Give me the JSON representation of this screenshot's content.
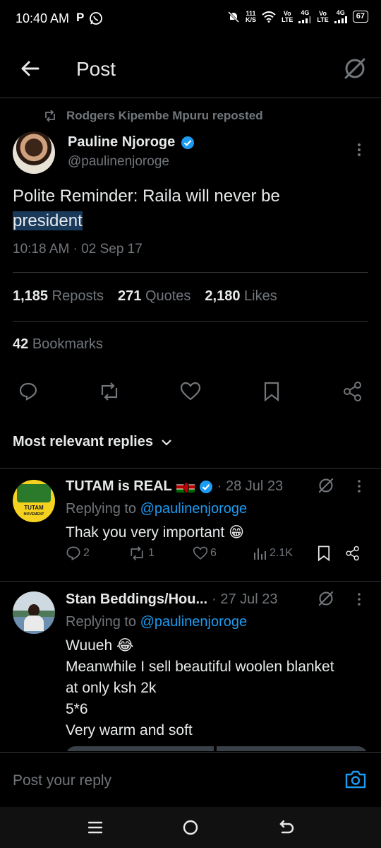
{
  "status_bar": {
    "time": "10:40 AM",
    "app_letter": "P",
    "net_speed_value": "111",
    "net_speed_unit": "K/S",
    "sim1_label_top": "Vo",
    "sim1_label_bottom": "LTE",
    "sim1_network": "4G",
    "sim2_label_top": "Vo",
    "sim2_label_bottom": "LTE",
    "sim2_network": "4G",
    "battery": "67"
  },
  "header": {
    "title": "Post"
  },
  "post": {
    "reposted_by": "Rodgers Kipembe Mpuru reposted",
    "author_name": "Pauline Njoroge",
    "author_handle": "@paulinenjoroge",
    "text_main": "Polite Reminder: Raila will never be",
    "text_highlight": "president",
    "timestamp": "10:18 AM · 02 Sep 17",
    "reposts_count": "1,185",
    "reposts_label": "Reposts",
    "quotes_count": "271",
    "quotes_label": "Quotes",
    "likes_count": "2,180",
    "likes_label": "Likes",
    "bookmarks_count": "42",
    "bookmarks_label": "Bookmarks"
  },
  "replies_header": {
    "label": "Most relevant replies"
  },
  "replies": [
    {
      "name": "TUTAM is REAL",
      "date": "· 28 Jul 23",
      "replying_prefix": "Replying to",
      "replying_to": "@paulinenjoroge",
      "text": "Thak you very important 😁",
      "avatar_text_1": "TUTAM",
      "avatar_text_2": "MOVEMENT",
      "replies": "2",
      "reposts": "1",
      "likes": "6",
      "views": "2.1K"
    },
    {
      "name": "Stan Beddings/Hou...",
      "date": "· 27 Jul 23",
      "replying_prefix": "Replying to",
      "replying_to": "@paulinenjoroge",
      "text_lines": [
        "Wuueh 😂",
        "Meanwhile I sell beautiful woolen blanket",
        "at only ksh 2k",
        "5*6",
        "Very warm and soft"
      ]
    }
  ],
  "composer": {
    "placeholder": "Post your reply"
  },
  "colors": {
    "accent": "#1d9bf0",
    "background": "#000000",
    "muted": "#71767b",
    "text": "#e7e9ea",
    "border": "#2f3336"
  }
}
